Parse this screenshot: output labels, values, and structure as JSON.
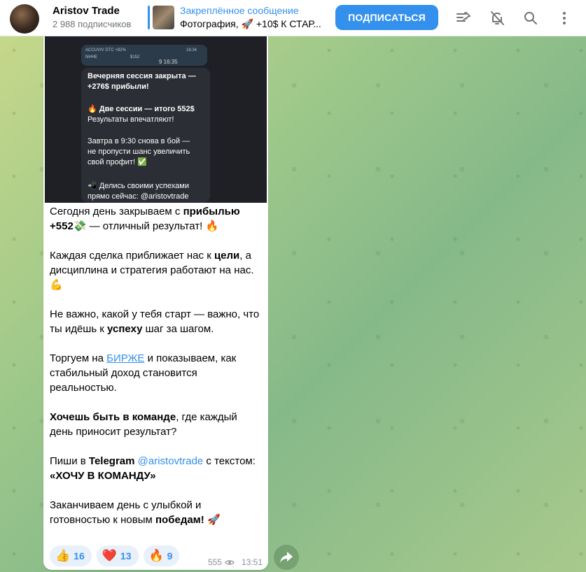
{
  "header": {
    "channel_title": "Aristov Trade",
    "subscribers": "2 988 подписчиков",
    "pinned_title": "Закреплённое сообщение",
    "pinned_text": "Фотография, 🚀 +10$ К СТАР...",
    "subscribe_label": "ПОДПИСАТЬСЯ",
    "icons": [
      "pinned-list-icon",
      "mute-icon",
      "search-icon",
      "more-icon"
    ]
  },
  "photo": {
    "mini_header": "ACCUVIV DTC +82%",
    "mini_time": "16:34",
    "mini_label": "NHHE",
    "mini_price": "$152",
    "time": "9 16:35",
    "lines": [
      "Вечерняя сессия закрыта —",
      "+276$ прибыли!",
      "",
      "🔥 Две сессии — итого 552$",
      "Результаты впечатляют!",
      "",
      "Завтра в 9:30 снова в бой —",
      "не пропусти шанс увеличить",
      "свой профит! ✅",
      "",
      "📲 Делись своими успехами",
      "прямо сейчас: @aristovtrade"
    ]
  },
  "message": {
    "p1_a": "Сегодня день закрываем с ",
    "p1_b": "прибылью",
    "p1_c": "+552",
    "p1_d": "💸 — отличный результат! 🔥",
    "p2_a": "Каждая сделка приближает нас к ",
    "p2_b": "цели",
    "p2_c": ", а дисциплина и стратегия работают на нас. 💪",
    "p3_a": "Не важно, какой у тебя старт — важно, что ты идёшь к ",
    "p3_b": "успеху",
    "p3_c": " шаг за шагом.",
    "p4_a": "Торгуем на ",
    "p4_link": "БИРЖЕ",
    "p4_c": " и показываем, как стабильный доход становится реальностью.",
    "p5_a": "Хочешь быть в команде",
    "p5_b": ", где каждый день приносит результат?",
    "p6_a": "Пиши в ",
    "p6_b": "Telegram",
    "p6_c": " ",
    "p6_link": "@aristovtrade",
    "p6_d": " с текстом:",
    "p6_e": "«ХОЧУ В КОМАНДУ»",
    "p7_a": "Заканчиваем день с улыбкой и готовностью к новым ",
    "p7_b": "победам!",
    "p7_c": " 🚀"
  },
  "reactions": [
    {
      "emoji": "👍",
      "count": "16"
    },
    {
      "emoji": "❤️",
      "count": "13"
    },
    {
      "emoji": "🔥",
      "count": "9"
    }
  ],
  "meta": {
    "views": "555",
    "time": "13:51"
  },
  "colors": {
    "accent": "#3390ec",
    "bubble": "#ffffff"
  }
}
